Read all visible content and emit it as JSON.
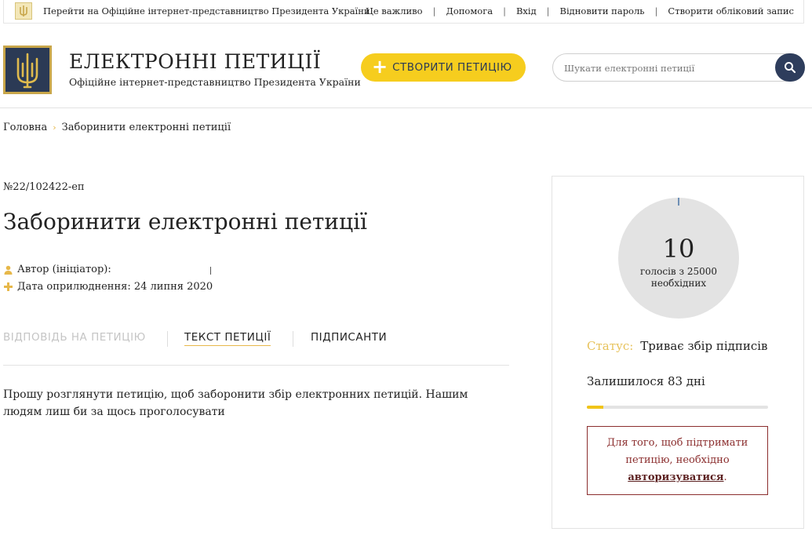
{
  "topbar": {
    "president_link": "Перейти на Офіційне інтернет-представництво Президента України",
    "nav": [
      {
        "label": "Це важливо"
      },
      {
        "label": "Допомога"
      },
      {
        "label": "Вхід"
      },
      {
        "label": "Відновити пароль"
      },
      {
        "label": "Створити обліковий запис"
      }
    ]
  },
  "header": {
    "title": "ЕЛЕКТРОННІ ПЕТИЦІЇ",
    "subtitle": "Офіційне інтернет-представництво Президента України",
    "create_button": "СТВОРИТИ ПЕТИЦІЮ",
    "search_placeholder": "Шукати електронні петиції"
  },
  "breadcrumb": {
    "home": "Головна",
    "current": "Заборинити електронні петиції"
  },
  "petition": {
    "number": "№22/102422-еп",
    "title": "Заборинити електронні петиції",
    "author_label": "Автор (ініціатор):",
    "date_label": "Дата оприлюднення: 24 липня 2020",
    "tabs": [
      {
        "label": "ВІДПОВІДЬ НА ПЕТИЦІЮ",
        "state": "disabled"
      },
      {
        "label": "ТЕКСТ ПЕТИЦІЇ",
        "state": "active"
      },
      {
        "label": "ПІДПИСАНТИ",
        "state": "normal"
      }
    ],
    "text": "Прошу розглянути петицію, щоб заборонити збір електронних петицій. Нашим людям лиш би за щось проголосувати"
  },
  "sidebar": {
    "votes": "10",
    "votes_of_line1": "голосів з 25000",
    "votes_of_line2": "необхідних",
    "vote_fraction": 0.0004,
    "status_label": "Статус:",
    "status_value": "Триває збір підписів",
    "remaining": "Залишилося 83 дні",
    "remaining_progress": 0.09,
    "auth_line1": "Для того, щоб підтримати",
    "auth_line2": "петицію, необхідно",
    "auth_link": "авторизуватися",
    "auth_tail": "."
  },
  "colors": {
    "accent_yellow": "#f6cd1e",
    "navy": "#2e3d5c",
    "auth_red": "#8b2e2e"
  }
}
